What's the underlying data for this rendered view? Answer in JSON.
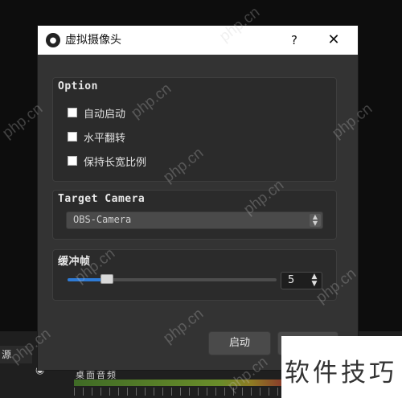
{
  "dialog": {
    "title": "虚拟摄像头",
    "help_label": "?",
    "close_label": "✕"
  },
  "option_group": {
    "title": "Option",
    "checkboxes": [
      {
        "label": "自动启动",
        "checked": false
      },
      {
        "label": "水平翻转",
        "checked": false
      },
      {
        "label": "保持长宽比例",
        "checked": false
      }
    ]
  },
  "target_group": {
    "title": "Target Camera",
    "selected": "OBS-Camera"
  },
  "buffer_group": {
    "title": "缓冲帧",
    "value": "5",
    "slider_fraction": 0.19
  },
  "buttons": {
    "start": "启动"
  },
  "background": {
    "source_label": "源",
    "mixer_label": "桌面音频"
  },
  "watermark": {
    "site": "php.cn",
    "corner_text": "软件技巧"
  },
  "colors": {
    "accent": "#2e7bd6",
    "dialog_bg": "#333333"
  }
}
